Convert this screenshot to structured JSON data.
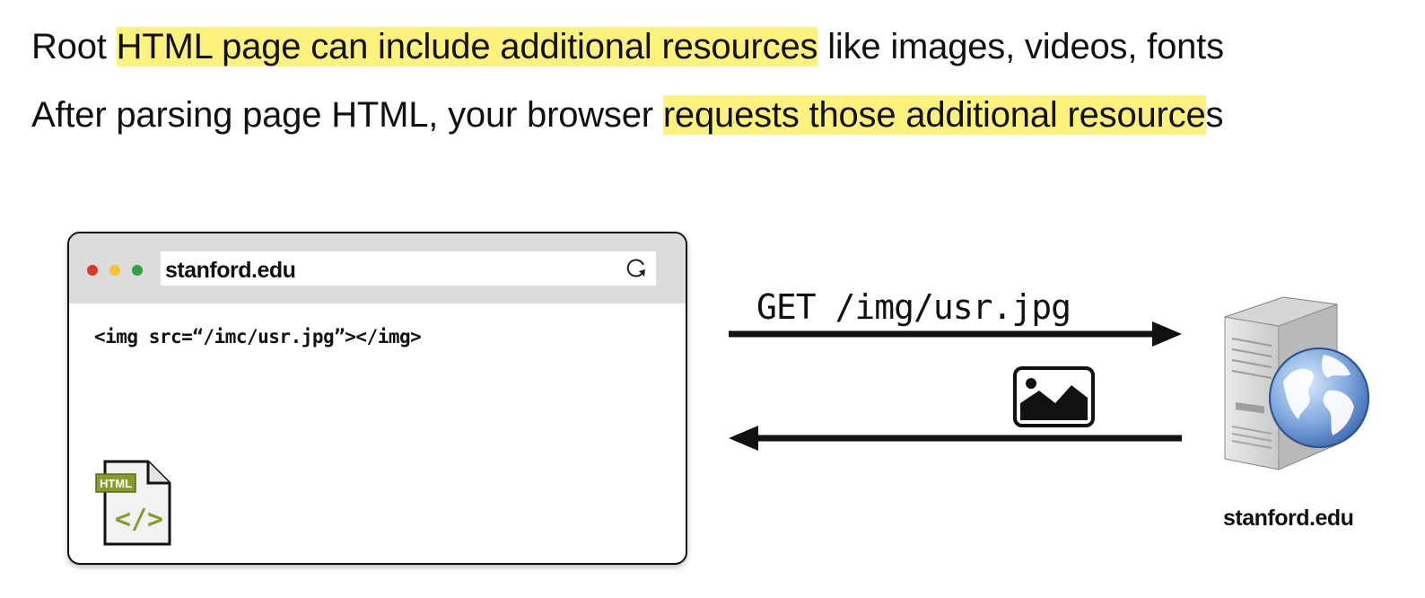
{
  "line1": {
    "before": "Root ",
    "highlight": "HTML page can include additional resources",
    "after": " like images, videos, fonts"
  },
  "line2": {
    "before": "After parsing page HTML, your browser ",
    "highlight": "requests those additional resource",
    "after": "s"
  },
  "browser": {
    "url": "stanford.edu",
    "code": "<img src=“/imc/usr.jpg”></img>",
    "file_badge": "HTML",
    "file_glyph": "</>"
  },
  "request": {
    "label": "GET /img/usr.jpg"
  },
  "server": {
    "label": "stanford.edu"
  },
  "colors": {
    "highlight": "#fdf27e",
    "dot_red": "#d23b2a",
    "dot_yellow": "#f2c332",
    "dot_green": "#34a040",
    "html_badge": "#8a9a2c"
  },
  "icons": [
    "reload-icon",
    "html-file-icon",
    "image-icon",
    "server-icon",
    "globe-icon"
  ]
}
